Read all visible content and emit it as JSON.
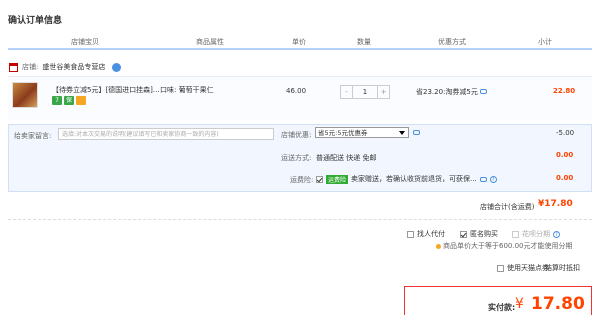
{
  "page": {
    "title": "确认订单信息"
  },
  "table_header": {
    "col1": "店铺宝贝",
    "col2": "商品属性",
    "col3": "单价",
    "col4": "数量",
    "col5": "优惠方式",
    "col6": "小计"
  },
  "shop": {
    "label": "店铺:",
    "name": "盛世谷美食品专营店"
  },
  "item": {
    "name": "【待券立减5元】[德国进口挂森]...",
    "attr": "口味: 葡萄干果仁",
    "price": "46.00",
    "qty_minus": "-",
    "qty": "1",
    "qty_plus": "+",
    "discount": "省23.20:淘券减5元",
    "subtotal": "22.80",
    "badges": [
      {
        "text": "7",
        "color": "#3aa64a"
      },
      {
        "text": "保",
        "color": "#3aa64a"
      },
      {
        "text": "",
        "color": "#f5a623"
      }
    ]
  },
  "options": {
    "message_label": "给卖家留言:",
    "message_placeholder": "选填:对本次交易的说明(建议填写已和卖家协商一致的内容)",
    "shop_discount_label": "店铺优惠:",
    "shop_discount_value": "省5元:5元优惠券",
    "shop_discount_amount": "-5.00",
    "shipping_label": "运送方式:",
    "shipping_value": "普通配送 快递 免邮",
    "shipping_amount": "0.00",
    "insurance_label": "运费险:",
    "insurance_tag": "运费险",
    "insurance_text": "卖家赠送，若确认收货前退货，可获保...",
    "insurance_amount": "0.00"
  },
  "totals": {
    "shop_total_label": "店铺合计(含运费)",
    "shop_total_value": "¥17.80"
  },
  "checkout": {
    "find_pay": "找人代付",
    "anonymous": "匿名购买",
    "installment": "花呗分期",
    "installment_note": "商品单价大于等于600.00元才能使用分期",
    "tmall_points": "使用天猫点券",
    "settle": "结算时抵扣",
    "pay_label": "实付款:",
    "pay_currency": "¥",
    "pay_amount": "17.80"
  },
  "colors": {
    "accent_red": "#ff4400",
    "header_line": "#b2d1ff",
    "option_bg": "#f2f7ff"
  }
}
